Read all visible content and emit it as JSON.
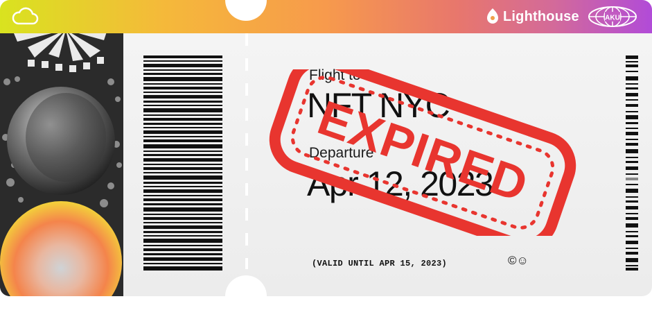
{
  "brand": {
    "name": "Lighthouse",
    "badge_text": "AKU"
  },
  "ticket": {
    "flight_label": "Flight to",
    "flight_value": "NFT NYC",
    "departure_label": "Departure",
    "departure_value": "Apr 12, 2023",
    "valid_note": "(VALID UNTIL APR 15, 2023)",
    "license_icons": "©☺"
  },
  "stamp": {
    "text": "EXPIRED",
    "color": "#e8352f"
  },
  "icons": [
    "cloud-icon",
    "lighthouse-logo-icon",
    "globe-badge-icon",
    "barcode",
    "cc-license-icon"
  ],
  "colors": {
    "header_gradient": [
      "#d9e31f",
      "#f79a4c",
      "#b14bd8"
    ],
    "stamp": "#e8352f"
  }
}
